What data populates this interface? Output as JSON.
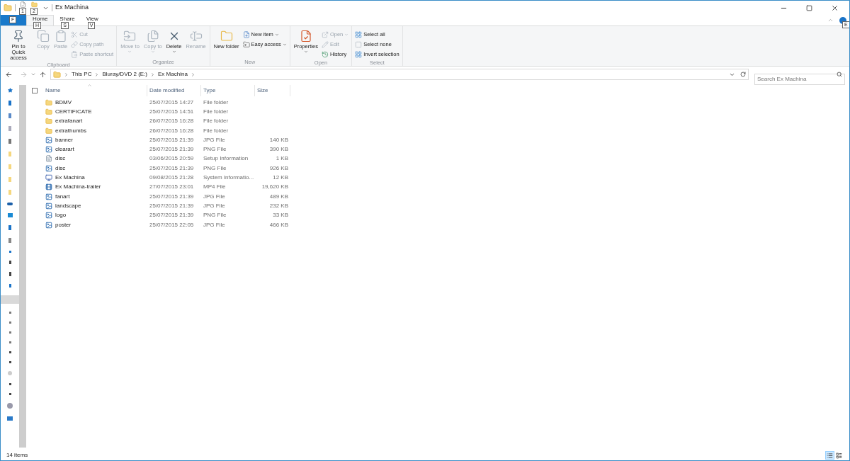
{
  "window": {
    "title": "Ex Machina",
    "quick_access_keytips": [
      "1",
      "2"
    ]
  },
  "file_tab": {
    "keytip": "F"
  },
  "tabs": [
    {
      "label": "Home",
      "keytip": "H",
      "selected": true
    },
    {
      "label": "Share",
      "keytip": "S",
      "selected": false
    },
    {
      "label": "View",
      "keytip": "V",
      "selected": false
    }
  ],
  "help_keytip": "E",
  "ribbon": [
    {
      "label": "Clipboard",
      "columns": [
        {
          "kind": "large",
          "label": "Pin to Quick access",
          "disabled": false,
          "dropdown": false
        },
        {
          "kind": "large",
          "label": "Copy",
          "disabled": true,
          "dropdown": false
        },
        {
          "kind": "large",
          "label": "Paste",
          "disabled": true,
          "dropdown": false
        },
        {
          "kind": "stack",
          "buttons": [
            {
              "label": "Cut",
              "disabled": true,
              "dropdown": false
            },
            {
              "label": "Copy path",
              "disabled": true,
              "dropdown": false
            },
            {
              "label": "Paste shortcut",
              "disabled": true,
              "dropdown": false
            }
          ]
        }
      ]
    },
    {
      "label": "Organize",
      "columns": [
        {
          "kind": "large",
          "label": "Move to",
          "disabled": true,
          "dropdown": true
        },
        {
          "kind": "large",
          "label": "Copy to",
          "disabled": true,
          "dropdown": true
        },
        {
          "kind": "large",
          "label": "Delete",
          "disabled": false,
          "dropdown": true
        },
        {
          "kind": "large",
          "label": "Rename",
          "disabled": true,
          "dropdown": false
        }
      ]
    },
    {
      "label": "New",
      "columns": [
        {
          "kind": "large",
          "label": "New folder",
          "disabled": false,
          "dropdown": false
        },
        {
          "kind": "stack",
          "buttons": [
            {
              "label": "New item",
              "disabled": false,
              "dropdown": true
            },
            {
              "label": "Easy access",
              "disabled": false,
              "dropdown": true
            }
          ]
        }
      ]
    },
    {
      "label": "Open",
      "columns": [
        {
          "kind": "large",
          "label": "Properties",
          "disabled": false,
          "dropdown": true
        },
        {
          "kind": "stack",
          "buttons": [
            {
              "label": "Open",
              "disabled": true,
              "dropdown": true
            },
            {
              "label": "Edit",
              "disabled": true,
              "dropdown": false
            },
            {
              "label": "History",
              "disabled": false,
              "dropdown": false
            }
          ]
        }
      ]
    },
    {
      "label": "Select",
      "columns": [
        {
          "kind": "stack",
          "buttons": [
            {
              "label": "Select all",
              "disabled": false,
              "dropdown": false
            },
            {
              "label": "Select none",
              "disabled": false,
              "dropdown": false
            },
            {
              "label": "Invert selection",
              "disabled": false,
              "dropdown": false
            }
          ]
        }
      ]
    }
  ],
  "address": {
    "crumbs": [
      "This PC",
      "Bluray/DVD 2 (E:)",
      "Ex Machina"
    ]
  },
  "search": {
    "placeholder": "Search Ex Machina"
  },
  "table": {
    "select_all_checked": false,
    "columns": [
      "Name",
      "Date modified",
      "Type",
      "Size"
    ],
    "rows": [
      {
        "kind": "folder",
        "name": "BDMV",
        "date": "25/07/2015 14:27",
        "type": "File folder",
        "size": ""
      },
      {
        "kind": "folder",
        "name": "CERTIFICATE",
        "date": "25/07/2015 14:51",
        "type": "File folder",
        "size": ""
      },
      {
        "kind": "folder",
        "name": "extrafanart",
        "date": "26/07/2015 16:28",
        "type": "File folder",
        "size": ""
      },
      {
        "kind": "folder",
        "name": "extrathumbs",
        "date": "26/07/2015 16:28",
        "type": "File folder",
        "size": ""
      },
      {
        "kind": "image",
        "name": "banner",
        "date": "25/07/2015 21:39",
        "type": "JPG File",
        "size": "140 KB"
      },
      {
        "kind": "image",
        "name": "clearart",
        "date": "25/07/2015 21:39",
        "type": "PNG File",
        "size": "390 KB"
      },
      {
        "kind": "setup",
        "name": "disc",
        "date": "03/06/2015 20:59",
        "type": "Setup Information",
        "size": "1 KB"
      },
      {
        "kind": "image",
        "name": "disc",
        "date": "25/07/2015 21:39",
        "type": "PNG File",
        "size": "926 KB"
      },
      {
        "kind": "sysinfo",
        "name": "Ex Machina",
        "date": "09/08/2015 21:28",
        "type": "System Informatio...",
        "size": "12 KB"
      },
      {
        "kind": "video",
        "name": "Ex Machina-trailer",
        "date": "27/07/2015 23:01",
        "type": "MP4 File",
        "size": "19,620 KB"
      },
      {
        "kind": "image",
        "name": "fanart",
        "date": "25/07/2015 21:39",
        "type": "JPG File",
        "size": "489 KB"
      },
      {
        "kind": "image",
        "name": "landscape",
        "date": "25/07/2015 21:39",
        "type": "JPG File",
        "size": "232 KB"
      },
      {
        "kind": "image",
        "name": "logo",
        "date": "25/07/2015 21:39",
        "type": "PNG File",
        "size": "33 KB"
      },
      {
        "kind": "image",
        "name": "poster",
        "date": "25/07/2015 22:05",
        "type": "JPG File",
        "size": "466 KB"
      }
    ]
  },
  "status_bar": {
    "text": "14 items",
    "views": [
      {
        "selected": true
      },
      {
        "selected": false
      }
    ]
  }
}
